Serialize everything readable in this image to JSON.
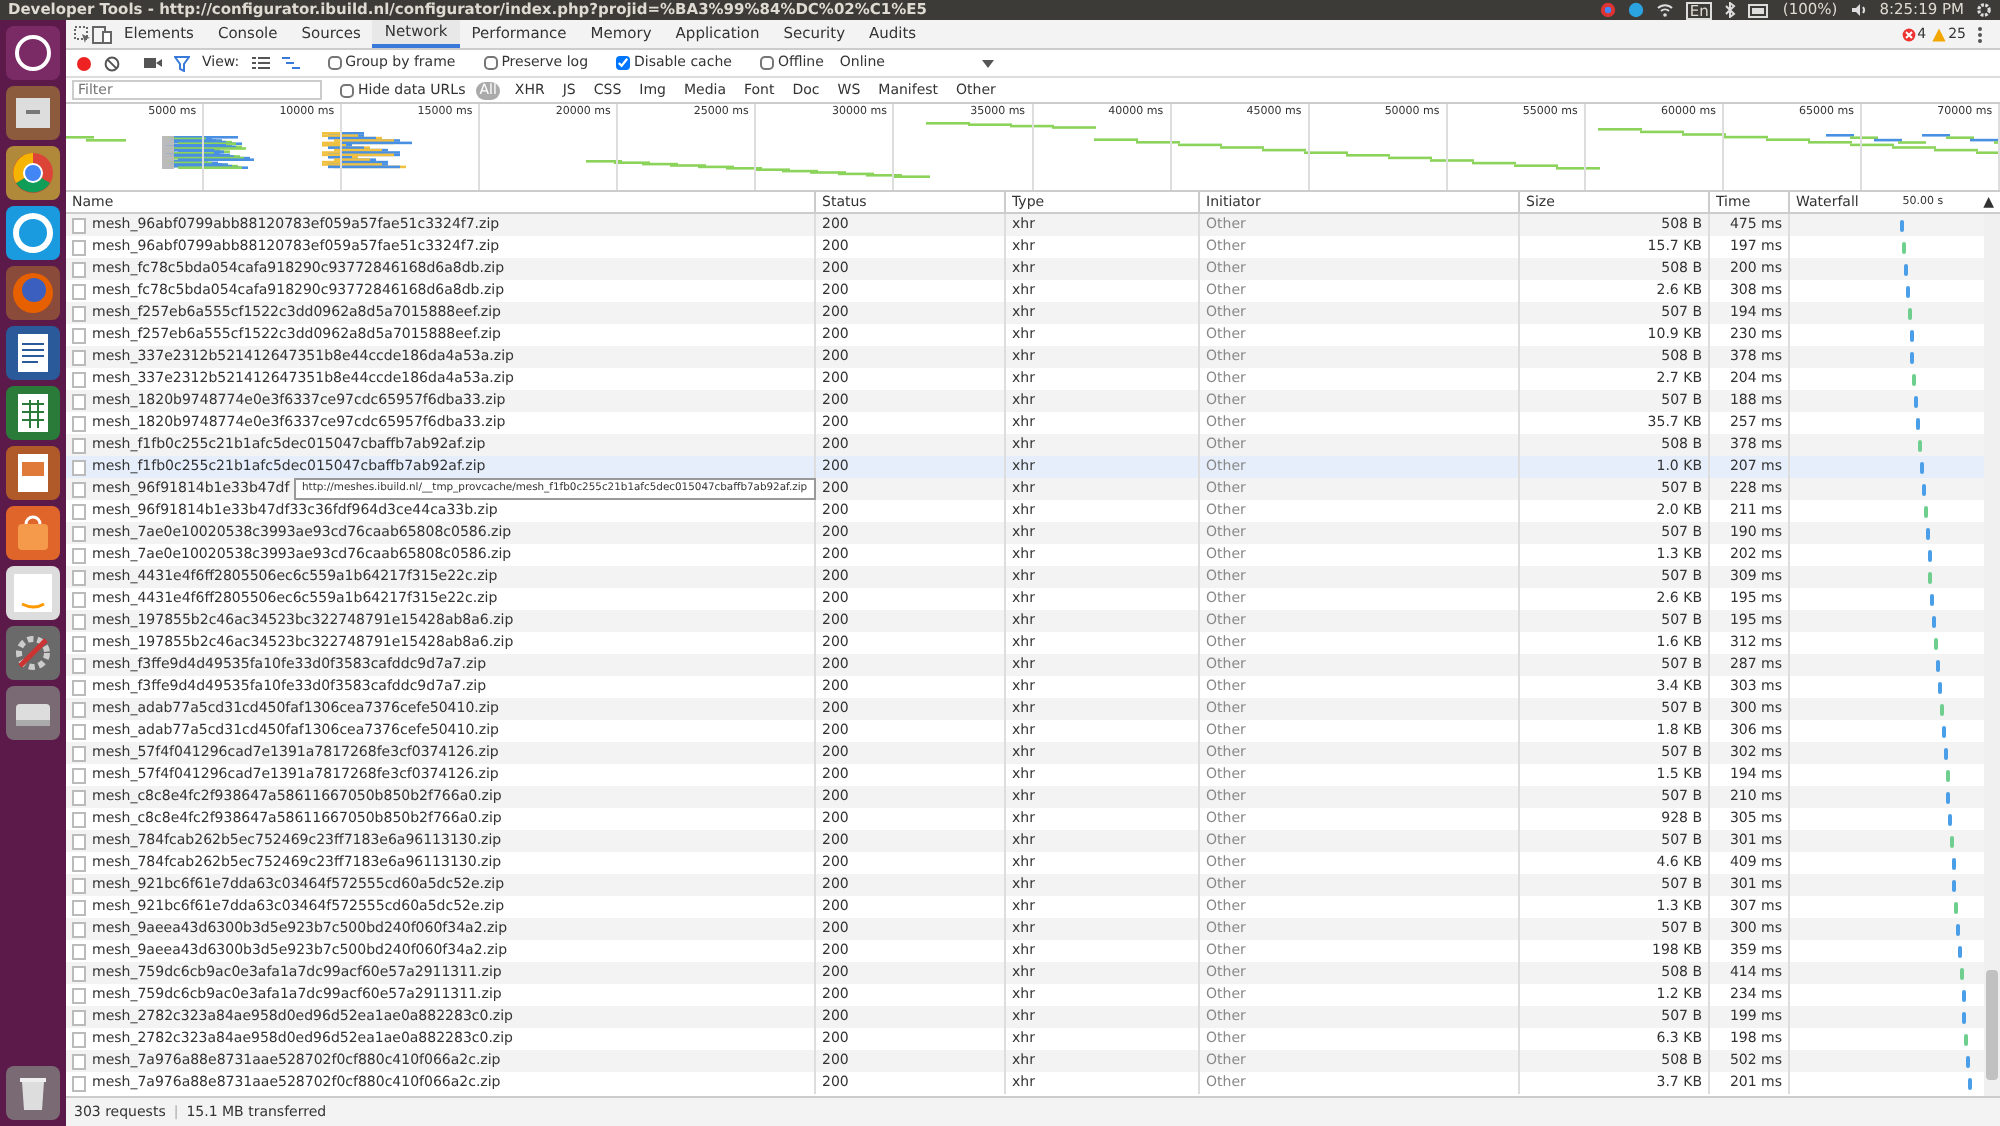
{
  "window": {
    "title": "Developer Tools - http://configurator.ibuild.nl/configurator/index.php?projid=%BA3%99%84%DC%02%C1%E5"
  },
  "tray": {
    "language": "En",
    "battery": "(100%)",
    "clock": "8:25:19 PM"
  },
  "tabs": [
    {
      "label": "Elements",
      "selected": false
    },
    {
      "label": "Console",
      "selected": false
    },
    {
      "label": "Sources",
      "selected": false
    },
    {
      "label": "Network",
      "selected": true
    },
    {
      "label": "Performance",
      "selected": false
    },
    {
      "label": "Memory",
      "selected": false
    },
    {
      "label": "Application",
      "selected": false
    },
    {
      "label": "Security",
      "selected": false
    },
    {
      "label": "Audits",
      "selected": false
    }
  ],
  "counters": {
    "errors": "4",
    "warnings": "25"
  },
  "toolbar": {
    "view_label": "View:",
    "checkboxes": [
      {
        "label": "Group by frame",
        "checked": false
      },
      {
        "label": "Preserve log",
        "checked": false
      },
      {
        "label": "Disable cache",
        "checked": true
      },
      {
        "label": "Offline",
        "checked": false
      }
    ],
    "throttling": "Online"
  },
  "filter_bar": {
    "placeholder": "Filter",
    "hide_data_urls": {
      "label": "Hide data URLs",
      "checked": false
    },
    "types": [
      {
        "label": "All",
        "selected": true
      },
      {
        "label": "XHR",
        "selected": false
      },
      {
        "label": "JS",
        "selected": false
      },
      {
        "label": "CSS",
        "selected": false
      },
      {
        "label": "Img",
        "selected": false
      },
      {
        "label": "Media",
        "selected": false
      },
      {
        "label": "Font",
        "selected": false
      },
      {
        "label": "Doc",
        "selected": false
      },
      {
        "label": "WS",
        "selected": false
      },
      {
        "label": "Manifest",
        "selected": false
      },
      {
        "label": "Other",
        "selected": false
      }
    ]
  },
  "overview": {
    "ticks": [
      "5000 ms",
      "10000 ms",
      "15000 ms",
      "20000 ms",
      "25000 ms",
      "30000 ms",
      "35000 ms",
      "40000 ms",
      "45000 ms",
      "50000 ms",
      "55000 ms",
      "60000 ms",
      "65000 ms",
      "70000 ms"
    ]
  },
  "table": {
    "columns": [
      "Name",
      "Status",
      "Type",
      "Initiator",
      "Size",
      "Time",
      "Waterfall"
    ],
    "waterfall_scale": "50.00 s",
    "sort_indicator": "▲",
    "rows": [
      {
        "name": "mesh_96abf0799abb88120783ef059a57fae51c3324f7.zip",
        "status": "200",
        "type": "xhr",
        "initiator": "Other",
        "size": "508 B",
        "time": "475 ms",
        "highlighted": false
      },
      {
        "name": "mesh_96abf0799abb88120783ef059a57fae51c3324f7.zip",
        "status": "200",
        "type": "xhr",
        "initiator": "Other",
        "size": "15.7 KB",
        "time": "197 ms",
        "highlighted": false
      },
      {
        "name": "mesh_fc78c5bda054cafa918290c93772846168d6a8db.zip",
        "status": "200",
        "type": "xhr",
        "initiator": "Other",
        "size": "508 B",
        "time": "200 ms",
        "highlighted": false
      },
      {
        "name": "mesh_fc78c5bda054cafa918290c93772846168d6a8db.zip",
        "status": "200",
        "type": "xhr",
        "initiator": "Other",
        "size": "2.6 KB",
        "time": "308 ms",
        "highlighted": false
      },
      {
        "name": "mesh_f257eb6a555cf1522c3dd0962a8d5a7015888eef.zip",
        "status": "200",
        "type": "xhr",
        "initiator": "Other",
        "size": "507 B",
        "time": "194 ms",
        "highlighted": false
      },
      {
        "name": "mesh_f257eb6a555cf1522c3dd0962a8d5a7015888eef.zip",
        "status": "200",
        "type": "xhr",
        "initiator": "Other",
        "size": "10.9 KB",
        "time": "230 ms",
        "highlighted": false
      },
      {
        "name": "mesh_337e2312b521412647351b8e44ccde186da4a53a.zip",
        "status": "200",
        "type": "xhr",
        "initiator": "Other",
        "size": "508 B",
        "time": "378 ms",
        "highlighted": false
      },
      {
        "name": "mesh_337e2312b521412647351b8e44ccde186da4a53a.zip",
        "status": "200",
        "type": "xhr",
        "initiator": "Other",
        "size": "2.7 KB",
        "time": "204 ms",
        "highlighted": false
      },
      {
        "name": "mesh_1820b9748774e0e3f6337ce97cdc65957f6dba33.zip",
        "status": "200",
        "type": "xhr",
        "initiator": "Other",
        "size": "507 B",
        "time": "188 ms",
        "highlighted": false
      },
      {
        "name": "mesh_1820b9748774e0e3f6337ce97cdc65957f6dba33.zip",
        "status": "200",
        "type": "xhr",
        "initiator": "Other",
        "size": "35.7 KB",
        "time": "257 ms",
        "highlighted": false
      },
      {
        "name": "mesh_f1fb0c255c21b1afc5dec015047cbaffb7ab92af.zip",
        "status": "200",
        "type": "xhr",
        "initiator": "Other",
        "size": "508 B",
        "time": "378 ms",
        "highlighted": false
      },
      {
        "name": "mesh_f1fb0c255c21b1afc5dec015047cbaffb7ab92af.zip",
        "status": "200",
        "type": "xhr",
        "initiator": "Other",
        "size": "1.0 KB",
        "time": "207 ms",
        "highlighted": true
      },
      {
        "name": "mesh_96f91814b1e33b47df",
        "status": "200",
        "type": "xhr",
        "initiator": "Other",
        "size": "507 B",
        "time": "228 ms",
        "highlighted": false,
        "tooltip": "http://meshes.ibuild.nl/__tmp_provcache/mesh_f1fb0c255c21b1afc5dec015047cbaffb7ab92af.zip"
      },
      {
        "name": "mesh_96f91814b1e33b47df33c36fdf964d3ce44ca33b.zip",
        "status": "200",
        "type": "xhr",
        "initiator": "Other",
        "size": "2.0 KB",
        "time": "211 ms",
        "highlighted": false
      },
      {
        "name": "mesh_7ae0e10020538c3993ae93cd76caab65808c0586.zip",
        "status": "200",
        "type": "xhr",
        "initiator": "Other",
        "size": "507 B",
        "time": "190 ms",
        "highlighted": false
      },
      {
        "name": "mesh_7ae0e10020538c3993ae93cd76caab65808c0586.zip",
        "status": "200",
        "type": "xhr",
        "initiator": "Other",
        "size": "1.3 KB",
        "time": "202 ms",
        "highlighted": false
      },
      {
        "name": "mesh_4431e4f6ff2805506ec6c559a1b64217f315e22c.zip",
        "status": "200",
        "type": "xhr",
        "initiator": "Other",
        "size": "507 B",
        "time": "309 ms",
        "highlighted": false
      },
      {
        "name": "mesh_4431e4f6ff2805506ec6c559a1b64217f315e22c.zip",
        "status": "200",
        "type": "xhr",
        "initiator": "Other",
        "size": "2.6 KB",
        "time": "195 ms",
        "highlighted": false
      },
      {
        "name": "mesh_197855b2c46ac34523bc322748791e15428ab8a6.zip",
        "status": "200",
        "type": "xhr",
        "initiator": "Other",
        "size": "507 B",
        "time": "195 ms",
        "highlighted": false
      },
      {
        "name": "mesh_197855b2c46ac34523bc322748791e15428ab8a6.zip",
        "status": "200",
        "type": "xhr",
        "initiator": "Other",
        "size": "1.6 KB",
        "time": "312 ms",
        "highlighted": false
      },
      {
        "name": "mesh_f3ffe9d4d49535fa10fe33d0f3583cafddc9d7a7.zip",
        "status": "200",
        "type": "xhr",
        "initiator": "Other",
        "size": "507 B",
        "time": "287 ms",
        "highlighted": false
      },
      {
        "name": "mesh_f3ffe9d4d49535fa10fe33d0f3583cafddc9d7a7.zip",
        "status": "200",
        "type": "xhr",
        "initiator": "Other",
        "size": "3.4 KB",
        "time": "303 ms",
        "highlighted": false
      },
      {
        "name": "mesh_adab77a5cd31cd450faf1306cea7376cefe50410.zip",
        "status": "200",
        "type": "xhr",
        "initiator": "Other",
        "size": "507 B",
        "time": "300 ms",
        "highlighted": false
      },
      {
        "name": "mesh_adab77a5cd31cd450faf1306cea7376cefe50410.zip",
        "status": "200",
        "type": "xhr",
        "initiator": "Other",
        "size": "1.8 KB",
        "time": "306 ms",
        "highlighted": false
      },
      {
        "name": "mesh_57f4f041296cad7e1391a7817268fe3cf0374126.zip",
        "status": "200",
        "type": "xhr",
        "initiator": "Other",
        "size": "507 B",
        "time": "302 ms",
        "highlighted": false
      },
      {
        "name": "mesh_57f4f041296cad7e1391a7817268fe3cf0374126.zip",
        "status": "200",
        "type": "xhr",
        "initiator": "Other",
        "size": "1.5 KB",
        "time": "194 ms",
        "highlighted": false
      },
      {
        "name": "mesh_c8c8e4fc2f938647a58611667050b850b2f766a0.zip",
        "status": "200",
        "type": "xhr",
        "initiator": "Other",
        "size": "507 B",
        "time": "210 ms",
        "highlighted": false
      },
      {
        "name": "mesh_c8c8e4fc2f938647a58611667050b850b2f766a0.zip",
        "status": "200",
        "type": "xhr",
        "initiator": "Other",
        "size": "928 B",
        "time": "305 ms",
        "highlighted": false
      },
      {
        "name": "mesh_784fcab262b5ec752469c23ff7183e6a96113130.zip",
        "status": "200",
        "type": "xhr",
        "initiator": "Other",
        "size": "507 B",
        "time": "301 ms",
        "highlighted": false
      },
      {
        "name": "mesh_784fcab262b5ec752469c23ff7183e6a96113130.zip",
        "status": "200",
        "type": "xhr",
        "initiator": "Other",
        "size": "4.6 KB",
        "time": "409 ms",
        "highlighted": false
      },
      {
        "name": "mesh_921bc6f61e7dda63c03464f572555cd60a5dc52e.zip",
        "status": "200",
        "type": "xhr",
        "initiator": "Other",
        "size": "507 B",
        "time": "301 ms",
        "highlighted": false
      },
      {
        "name": "mesh_921bc6f61e7dda63c03464f572555cd60a5dc52e.zip",
        "status": "200",
        "type": "xhr",
        "initiator": "Other",
        "size": "1.3 KB",
        "time": "307 ms",
        "highlighted": false
      },
      {
        "name": "mesh_9aeea43d6300b3d5e923b7c500bd240f060f34a2.zip",
        "status": "200",
        "type": "xhr",
        "initiator": "Other",
        "size": "507 B",
        "time": "300 ms",
        "highlighted": false
      },
      {
        "name": "mesh_9aeea43d6300b3d5e923b7c500bd240f060f34a2.zip",
        "status": "200",
        "type": "xhr",
        "initiator": "Other",
        "size": "198 KB",
        "time": "359 ms",
        "highlighted": false
      },
      {
        "name": "mesh_759dc6cb9ac0e3afa1a7dc99acf60e57a2911311.zip",
        "status": "200",
        "type": "xhr",
        "initiator": "Other",
        "size": "508 B",
        "time": "414 ms",
        "highlighted": false
      },
      {
        "name": "mesh_759dc6cb9ac0e3afa1a7dc99acf60e57a2911311.zip",
        "status": "200",
        "type": "xhr",
        "initiator": "Other",
        "size": "1.2 KB",
        "time": "234 ms",
        "highlighted": false
      },
      {
        "name": "mesh_2782c323a84ae958d0ed96d52ea1ae0a882283c0.zip",
        "status": "200",
        "type": "xhr",
        "initiator": "Other",
        "size": "507 B",
        "time": "199 ms",
        "highlighted": false
      },
      {
        "name": "mesh_2782c323a84ae958d0ed96d52ea1ae0a882283c0.zip",
        "status": "200",
        "type": "xhr",
        "initiator": "Other",
        "size": "6.3 KB",
        "time": "198 ms",
        "highlighted": false
      },
      {
        "name": "mesh_7a976a88e8731aae528702f0cf880c410f066a2c.zip",
        "status": "200",
        "type": "xhr",
        "initiator": "Other",
        "size": "508 B",
        "time": "502 ms",
        "highlighted": false
      },
      {
        "name": "mesh_7a976a88e8731aae528702f0cf880c410f066a2c.zip",
        "status": "200",
        "type": "xhr",
        "initiator": "Other",
        "size": "3.7 KB",
        "time": "201 ms",
        "highlighted": false
      }
    ]
  },
  "status_bar": {
    "requests": "303 requests",
    "separator": "|",
    "transferred": "15.1 MB transferred"
  }
}
